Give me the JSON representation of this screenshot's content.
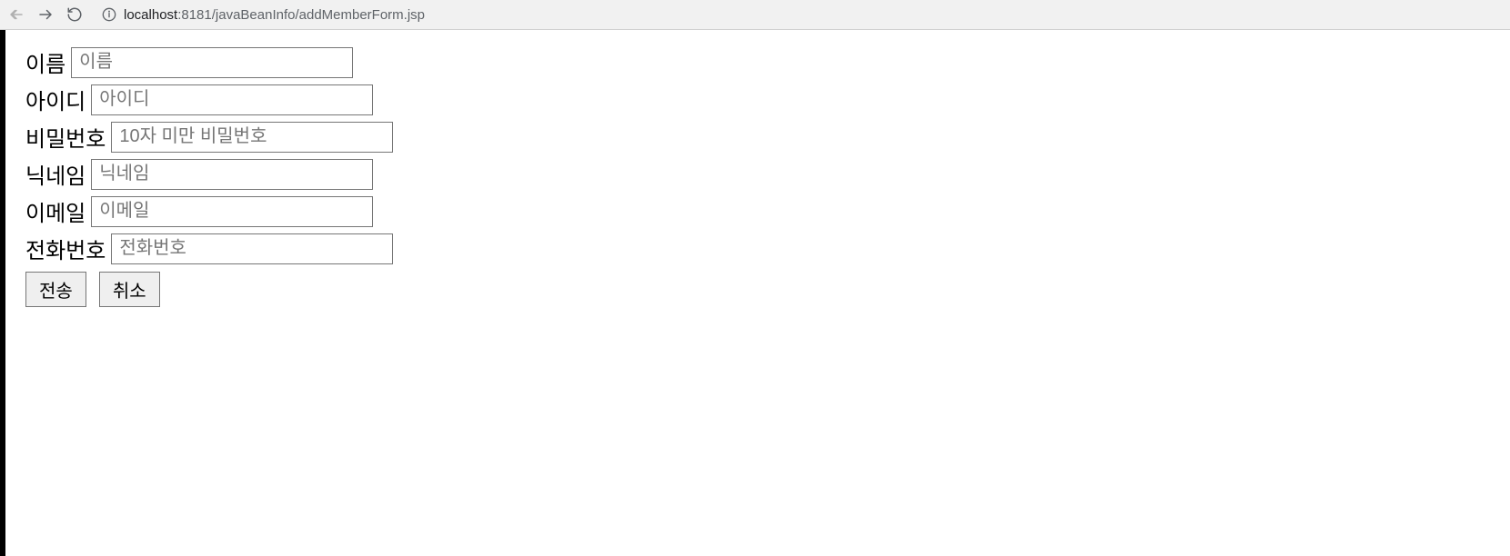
{
  "browser": {
    "url_host": "localhost",
    "url_rest": ":8181/javaBeanInfo/addMemberForm.jsp"
  },
  "form": {
    "fields": [
      {
        "label": "이름",
        "placeholder": "이름",
        "value": ""
      },
      {
        "label": "아이디",
        "placeholder": "아이디",
        "value": ""
      },
      {
        "label": "비밀번호",
        "placeholder": "10자 미만 비밀번호",
        "value": ""
      },
      {
        "label": "닉네임",
        "placeholder": "닉네임",
        "value": ""
      },
      {
        "label": "이메일",
        "placeholder": "이메일",
        "value": ""
      },
      {
        "label": "전화번호",
        "placeholder": "전화번호",
        "value": ""
      }
    ],
    "buttons": {
      "submit": "전송",
      "cancel": "취소"
    }
  }
}
